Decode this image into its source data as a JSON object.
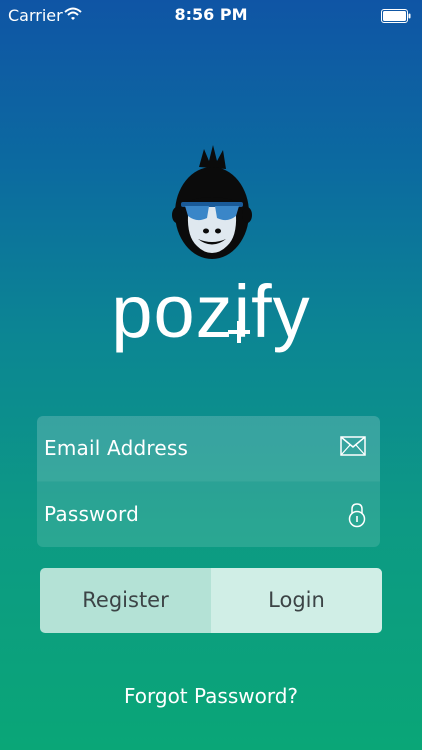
{
  "status_bar": {
    "carrier": "Carrier",
    "time": "8:56 PM"
  },
  "logo": {
    "wordmark": "pozify",
    "icon": "gorilla-sunglasses-logo"
  },
  "form": {
    "email_label": "Email Address",
    "password_label": "Password",
    "email_icon": "envelope-icon",
    "password_icon": "lock-icon"
  },
  "actions": {
    "register_label": "Register",
    "login_label": "Login",
    "forgot_label": "Forgot Password?"
  },
  "colors": {
    "gradient_top": "#0f55a5",
    "gradient_bottom": "#0aa677",
    "register_bg": "#b4e2d6",
    "login_bg": "#d0eee6",
    "button_text": "#3c4446"
  }
}
